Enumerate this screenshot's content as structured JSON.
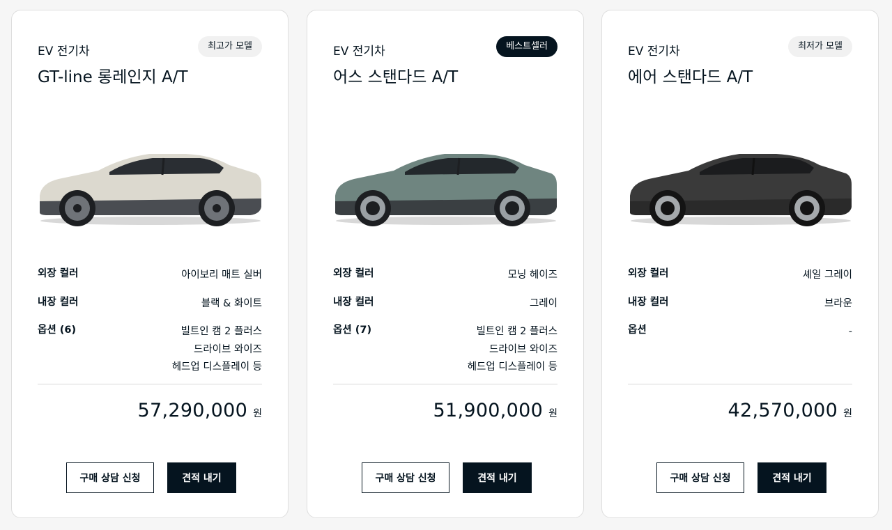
{
  "cards": [
    {
      "category": "EV 전기차",
      "badge": "최고가 모델",
      "title": "GT-line 롱레인지 A/T",
      "car_color": "ivory",
      "specs": {
        "exterior_label": "외장 컬러",
        "exterior_value": "아이보리 매트 실버",
        "interior_label": "내장 컬러",
        "interior_value": "블랙 & 화이트",
        "options_label": "옵션 (6)",
        "options": [
          "빌트인 캠 2 플러스",
          "드라이브 와이즈",
          "헤드업 디스플레이 등"
        ]
      },
      "price": "57,290,000",
      "unit": "원",
      "consult_label": "구매 상담 신청",
      "quote_label": "견적 내기"
    },
    {
      "category": "EV 전기차",
      "badge": "베스트셀러",
      "title": "어스 스탠다드 A/T",
      "car_color": "teal-grey",
      "specs": {
        "exterior_label": "외장 컬러",
        "exterior_value": "모닝 헤이즈",
        "interior_label": "내장 컬러",
        "interior_value": "그레이",
        "options_label": "옵션 (7)",
        "options": [
          "빌트인 캠 2 플러스",
          "드라이브 와이즈",
          "헤드업 디스플레이 등"
        ]
      },
      "price": "51,900,000",
      "unit": "원",
      "consult_label": "구매 상담 신청",
      "quote_label": "견적 내기"
    },
    {
      "category": "EV 전기차",
      "badge": "최저가 모델",
      "title": "에어 스탠다드 A/T",
      "car_color": "dark-grey",
      "specs": {
        "exterior_label": "외장 컬러",
        "exterior_value": "셰일 그레이",
        "interior_label": "내장 컬러",
        "interior_value": "브라운",
        "options_label": "옵션",
        "options": [
          "-"
        ]
      },
      "price": "42,570,000",
      "unit": "원",
      "consult_label": "구매 상담 신청",
      "quote_label": "견적 내기"
    }
  ],
  "colors": {
    "brand_dark": "#05141f",
    "badge_light": "#f1f1f1",
    "card_border": "#dedede",
    "ivory_body": "#d9d6cc",
    "teal_body": "#6f8580",
    "dark_body": "#3a3a3a"
  }
}
